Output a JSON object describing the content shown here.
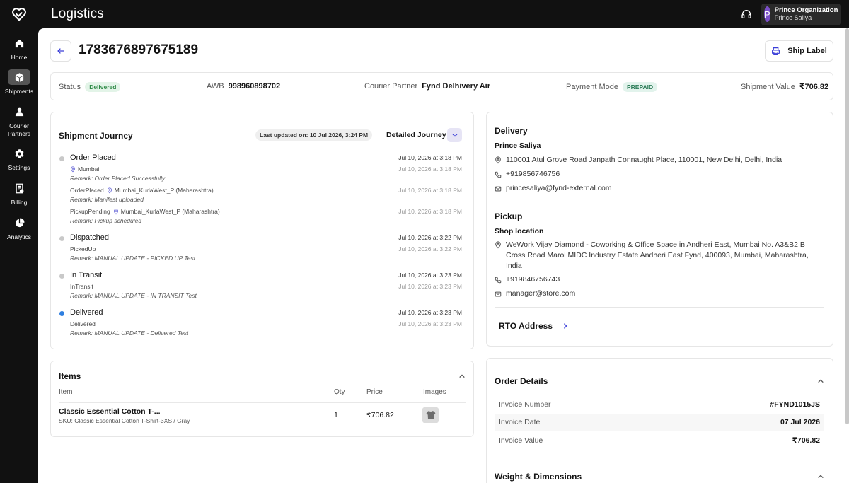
{
  "app": {
    "title": "Logistics"
  },
  "user": {
    "initial": "P",
    "org_name": "Prince Organization",
    "user_name": "Prince Saliya"
  },
  "sidebar": {
    "items": [
      {
        "label": "Home",
        "icon": "home-icon"
      },
      {
        "label": "Shipments",
        "icon": "box-icon",
        "active": true
      },
      {
        "label": "Courier\nPartners",
        "icon": "person-icon"
      },
      {
        "label": "Settings",
        "icon": "gear-icon"
      },
      {
        "label": "Billing",
        "icon": "billing-icon"
      },
      {
        "label": "Analytics",
        "icon": "pie-chart-icon"
      }
    ]
  },
  "header": {
    "shipment_id": "1783676897675189",
    "ship_label": "Ship Label"
  },
  "status_bar": {
    "status_label": "Status",
    "status_value": "Delivered",
    "awb_label": "AWB",
    "awb_value": "998960898702",
    "courier_label": "Courier Partner",
    "courier_value": "Fynd Delhivery Air",
    "payment_label": "Payment Mode",
    "payment_value": "PREPAID",
    "value_label": "Shipment Value",
    "value_value": "₹706.82"
  },
  "journey": {
    "title": "Shipment Journey",
    "last_updated": "Last updated on: 10 Jul 2026, 3:24 PM",
    "detailed_label": "Detailed Journey",
    "steps": [
      {
        "title": "Order Placed",
        "date": "Jul 10, 2026 at 3:18 PM",
        "events": [
          {
            "status": "",
            "location": "Mumbai",
            "date": "Jul 10, 2026 at 3:18 PM",
            "remark": "Remark: Order Placed Successfully"
          },
          {
            "status": "OrderPlaced",
            "location": "Mumbai_KurlaWest_P (Maharashtra)",
            "date": "Jul 10, 2026 at 3:18 PM",
            "remark": "Remark: Manifest uploaded"
          },
          {
            "status": "PickupPending",
            "location": "Mumbai_KurlaWest_P (Maharashtra)",
            "date": "Jul 10, 2026 at 3:18 PM",
            "remark": "Remark: Pickup scheduled"
          }
        ]
      },
      {
        "title": "Dispatched",
        "date": "Jul 10, 2026 at 3:22 PM",
        "events": [
          {
            "status": "PickedUp",
            "date": "Jul 10, 2026 at 3:22 PM",
            "remark": "Remark: MANUAL UPDATE - PICKED UP Test"
          }
        ]
      },
      {
        "title": "In Transit",
        "date": "Jul 10, 2026 at 3:23 PM",
        "events": [
          {
            "status": "InTransit",
            "date": "Jul 10, 2026 at 3:23 PM",
            "remark": "Remark: MANUAL UPDATE - IN TRANSIT Test"
          }
        ]
      },
      {
        "title": "Delivered",
        "date": "Jul 10, 2026 at 3:23 PM",
        "events": [
          {
            "status": "Delivered",
            "date": "Jul 10, 2026 at 3:23 PM",
            "remark": "Remark: MANUAL UPDATE - Delivered Test"
          }
        ]
      }
    ]
  },
  "items": {
    "title": "Items",
    "headers": {
      "item": "Item",
      "qty": "Qty",
      "price": "Price",
      "images": "Images"
    },
    "rows": [
      {
        "name": "Classic Essential Cotton T-...",
        "sku": "SKU: Classic Essential Cotton T-Shirt-3XS / Gray",
        "qty": "1",
        "price": "₹706.82"
      }
    ]
  },
  "delivery": {
    "title": "Delivery",
    "name": "Prince Saliya",
    "address": "110001 Atul Grove Road Janpath Connaught Place, 110001, New Delhi, Delhi, India",
    "phone": "+919856746756",
    "email": "princesaliya@fynd-external.com"
  },
  "pickup": {
    "title": "Pickup",
    "name": "Shop location",
    "address": "WeWork Vijay Diamond - Coworking & Office Space in Andheri East, Mumbai No. A3&B2 B Cross Road Marol MIDC Industry Estate Andheri East Fynd, 400093, Mumbai, Maharashtra, India",
    "phone": "+919846756743",
    "email": "manager@store.com"
  },
  "rto": {
    "label": "RTO Address"
  },
  "order_details": {
    "title": "Order Details",
    "rows": [
      {
        "label": "Invoice Number",
        "value": "#FYND1015JS"
      },
      {
        "label": "Invoice Date",
        "value": "07 Jul 2026"
      },
      {
        "label": "Invoice Value",
        "value": "₹706.82"
      }
    ]
  },
  "weight": {
    "title": "Weight & Dimensions"
  },
  "colors": {
    "accent": "#3b3fd8",
    "status_green": "#2f8a47",
    "active_dot": "#2f7fe0"
  }
}
